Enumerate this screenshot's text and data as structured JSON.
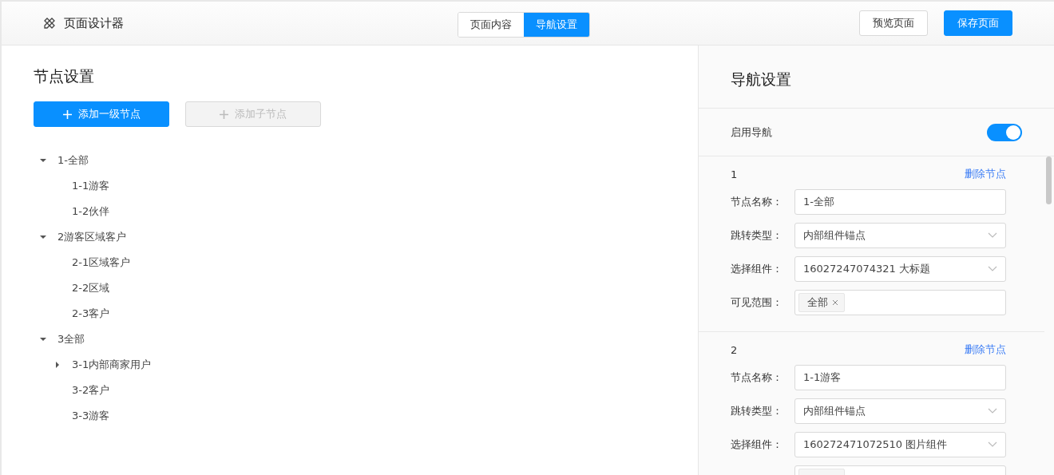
{
  "header": {
    "title": "页面设计器",
    "tabs": [
      {
        "label": "页面内容",
        "selected": false
      },
      {
        "label": "导航设置",
        "selected": true
      }
    ],
    "buttons": [
      {
        "label": "预览页面",
        "kind": "default"
      },
      {
        "label": "保存页面",
        "kind": "primary"
      }
    ]
  },
  "tree_panel": {
    "title": "节点设置",
    "buttons": [
      {
        "label": "添加一级节点",
        "disabled": false
      },
      {
        "label": "添加子节点",
        "disabled": true
      }
    ],
    "nodes": [
      {
        "label": "1-全部",
        "expanded": true,
        "children": [
          {
            "label": "1-1游客"
          },
          {
            "label": "1-2伙伴"
          }
        ]
      },
      {
        "label": "2游客区域客户",
        "expanded": true,
        "children": [
          {
            "label": "2-1区域客户"
          },
          {
            "label": "2-2区域"
          },
          {
            "label": "2-3客户"
          }
        ]
      },
      {
        "label": "3全部",
        "expanded": true,
        "children": [
          {
            "label": "3-1内部商家用户",
            "expanded": false
          },
          {
            "label": "3-2客户"
          },
          {
            "label": "3-3游客"
          }
        ]
      }
    ]
  },
  "nav_panel": {
    "title": "导航设置",
    "enable_label": "启用导航",
    "enabled": true,
    "nodes": [
      {
        "index": "1",
        "delete_label": "删除节点",
        "fields": [
          {
            "kind": "input",
            "label": "节点名称：",
            "value": "1-全部"
          },
          {
            "kind": "select",
            "label": "跳转类型：",
            "value": "内部组件锚点"
          },
          {
            "kind": "select",
            "label": "选择组件：",
            "value": "16027247074321 大标题"
          },
          {
            "kind": "tags",
            "label": "可见范围：",
            "tags": [
              "全部"
            ]
          }
        ]
      },
      {
        "index": "2",
        "delete_label": "删除节点",
        "fields": [
          {
            "kind": "input",
            "label": "节点名称：",
            "value": "1-1游客"
          },
          {
            "kind": "select",
            "label": "跳转类型：",
            "value": "内部组件锚点"
          },
          {
            "kind": "select",
            "label": "选择组件：",
            "value": "160272471072510 图片组件"
          },
          {
            "kind": "tags",
            "tag_cut": true
          }
        ]
      }
    ]
  }
}
